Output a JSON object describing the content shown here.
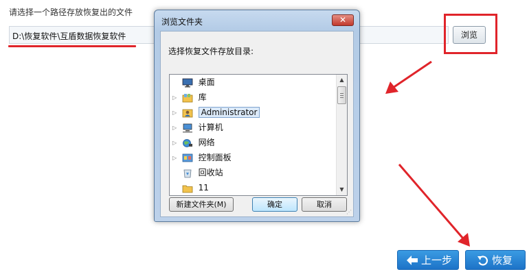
{
  "prompt": {
    "text": "请选择一个路径存放恢复出的文件"
  },
  "path": {
    "value": "D:\\恢复软件\\互盾数据恢复软件"
  },
  "browse": {
    "label": "浏览"
  },
  "dialog": {
    "title": "浏览文件夹",
    "close_label": "✕",
    "instruction": "选择恢复文件存放目录:",
    "tree": [
      {
        "label": "桌面",
        "icon": "desktop-icon",
        "expandable": false,
        "selected": false
      },
      {
        "label": "库",
        "icon": "library-icon",
        "expandable": true,
        "selected": false
      },
      {
        "label": "Administrator",
        "icon": "user-folder-icon",
        "expandable": true,
        "selected": true
      },
      {
        "label": "计算机",
        "icon": "computer-icon",
        "expandable": true,
        "selected": false
      },
      {
        "label": "网络",
        "icon": "network-icon",
        "expandable": true,
        "selected": false
      },
      {
        "label": "控制面板",
        "icon": "control-panel-icon",
        "expandable": true,
        "selected": false
      },
      {
        "label": "回收站",
        "icon": "recycle-bin-icon",
        "expandable": false,
        "selected": false
      },
      {
        "label": "11",
        "icon": "folder-icon",
        "expandable": false,
        "selected": false
      }
    ],
    "new_folder_label": "新建文件夹(M)",
    "ok_label": "确定",
    "cancel_label": "取消"
  },
  "nav": {
    "back_label": "上一步",
    "recover_label": "恢复"
  },
  "colors": {
    "highlight_red": "#e0242a",
    "nav_blue": "#2a86d8"
  }
}
